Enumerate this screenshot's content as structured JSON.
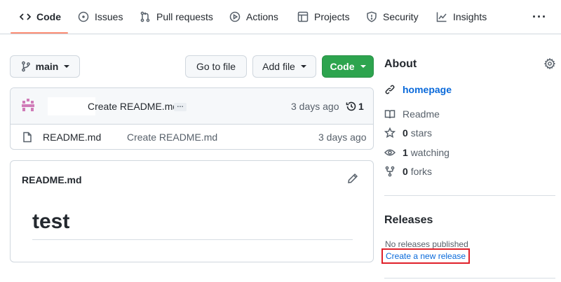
{
  "nav": {
    "tabs": [
      {
        "label": "Code",
        "icon": "code-icon"
      },
      {
        "label": "Issues",
        "icon": "issue-icon"
      },
      {
        "label": "Pull requests",
        "icon": "pull-request-icon"
      },
      {
        "label": "Actions",
        "icon": "play-icon"
      },
      {
        "label": "Projects",
        "icon": "table-icon"
      },
      {
        "label": "Security",
        "icon": "shield-icon"
      },
      {
        "label": "Insights",
        "icon": "graph-icon"
      }
    ],
    "more": "···",
    "active_tab": "Code",
    "active_color": "#fd8c73"
  },
  "toolbar": {
    "branch": "main",
    "go_to_file": "Go to file",
    "add_file": "Add file",
    "code": "Code",
    "code_button_color": "#2da44e"
  },
  "latest_commit": {
    "message": "Create README.md",
    "ellipsis": "…",
    "time": "3 days ago",
    "history_count": "1"
  },
  "files": [
    {
      "name": "README.md",
      "commit_message": "Create README.md",
      "time": "3 days ago"
    }
  ],
  "readme": {
    "title": "README.md",
    "heading": "test"
  },
  "about": {
    "title": "About",
    "homepage": "homepage",
    "readme": "Readme",
    "stars_count": "0",
    "stars_label": "stars",
    "watching_count": "1",
    "watching_label": "watching",
    "forks_count": "0",
    "forks_label": "forks"
  },
  "releases": {
    "title": "Releases",
    "none_text": "No releases published",
    "create_link": "Create a new release",
    "highlight_color": "#e0202a"
  },
  "colors": {
    "link": "#0969da",
    "border": "#d0d7de"
  }
}
